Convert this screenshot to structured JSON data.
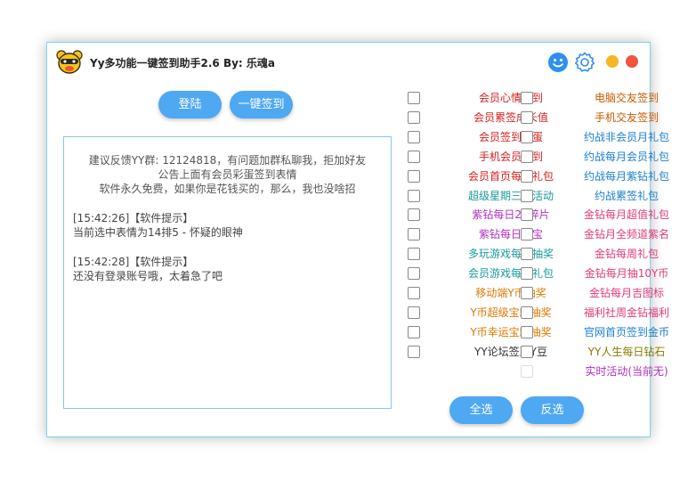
{
  "window": {
    "title": "Yy多功能一键签到助手2.6 By: 乐魂a",
    "logo": "bear-mascot-icon",
    "icons": {
      "smiley": "smiley-icon",
      "settings": "gear-icon"
    },
    "dots": {
      "minimize": "#f5b623",
      "close": "#f2543c"
    }
  },
  "buttons": {
    "login": "登陆",
    "sign_all": "一键签到",
    "select_all": "全选",
    "invert": "反选"
  },
  "colors": {
    "button_blue": "#4ea8f2",
    "accent_blue": "#2d8ff0"
  },
  "notice": [
    "建议反馈YY群: 12124818，有问题加群私聊我，拒加好友",
    "公告上面有会员彩蛋签到表情",
    "软件永久免费，如果你是花钱买的，那么，我也没啥招"
  ],
  "log": [
    {
      "time": "[15:42:26]【软件提示】",
      "message": "当前选中表情为14排5 - 怀疑的眼神"
    },
    {
      "time": "[15:42:28]【软件提示】",
      "message": "还没有登录账号哦，太着急了吧"
    }
  ],
  "options_left": [
    {
      "label": "会员心情签到",
      "color": "#d42020"
    },
    {
      "label": "会员累签成长值",
      "color": "#d42020"
    },
    {
      "label": "会员签到彩蛋",
      "color": "#d42020"
    },
    {
      "label": "手机会员签到",
      "color": "#d42020"
    },
    {
      "label": "会员首页每日礼包",
      "color": "#d42020"
    },
    {
      "label": "超级星期三周活动",
      "color": "#1a9a9a"
    },
    {
      "label": "紫钻每日25碎片",
      "color": "#b030c0"
    },
    {
      "label": "紫钻每日挖宝",
      "color": "#b030c0"
    },
    {
      "label": "多玩游戏每日抽奖",
      "color": "#1a9a9a"
    },
    {
      "label": "会员游戏每日礼包",
      "color": "#1a9a9a"
    },
    {
      "label": "移动端Y币抽奖",
      "color": "#e07800"
    },
    {
      "label": "Y币超级宝箱抽奖",
      "color": "#e07800"
    },
    {
      "label": "Y币幸运宝箱抽奖",
      "color": "#e07800"
    },
    {
      "label": "YY论坛签到Y豆",
      "color": "#333333"
    }
  ],
  "options_right": [
    {
      "label": "电脑交友签到",
      "color": "#c85a00"
    },
    {
      "label": "手机交友签到",
      "color": "#c85a00"
    },
    {
      "label": "约战非会员月礼包",
      "color": "#1a7fd0"
    },
    {
      "label": "约战每月会员礼包",
      "color": "#1a7fd0"
    },
    {
      "label": "约战每月紫钻礼包",
      "color": "#1a7fd0"
    },
    {
      "label": "约战累签礼包",
      "color": "#1a7fd0"
    },
    {
      "label": "金钻每月超值礼包",
      "color": "#e03a7a"
    },
    {
      "label": "金钻月全频道紫名",
      "color": "#e03a7a"
    },
    {
      "label": "金钻每周礼包",
      "color": "#e03a7a"
    },
    {
      "label": "金钻每月抽10Y币",
      "color": "#e03a7a"
    },
    {
      "label": "金钻每月吉图标",
      "color": "#e03a7a"
    },
    {
      "label": "福利社周金钻福利",
      "color": "#e03a7a"
    },
    {
      "label": "官网首页签到金币",
      "color": "#1a7fd0"
    },
    {
      "label": "YY人生每日钻石",
      "color": "#8a7a00"
    },
    {
      "label": "实时活动(当前无)",
      "color": "#b030c0"
    }
  ]
}
